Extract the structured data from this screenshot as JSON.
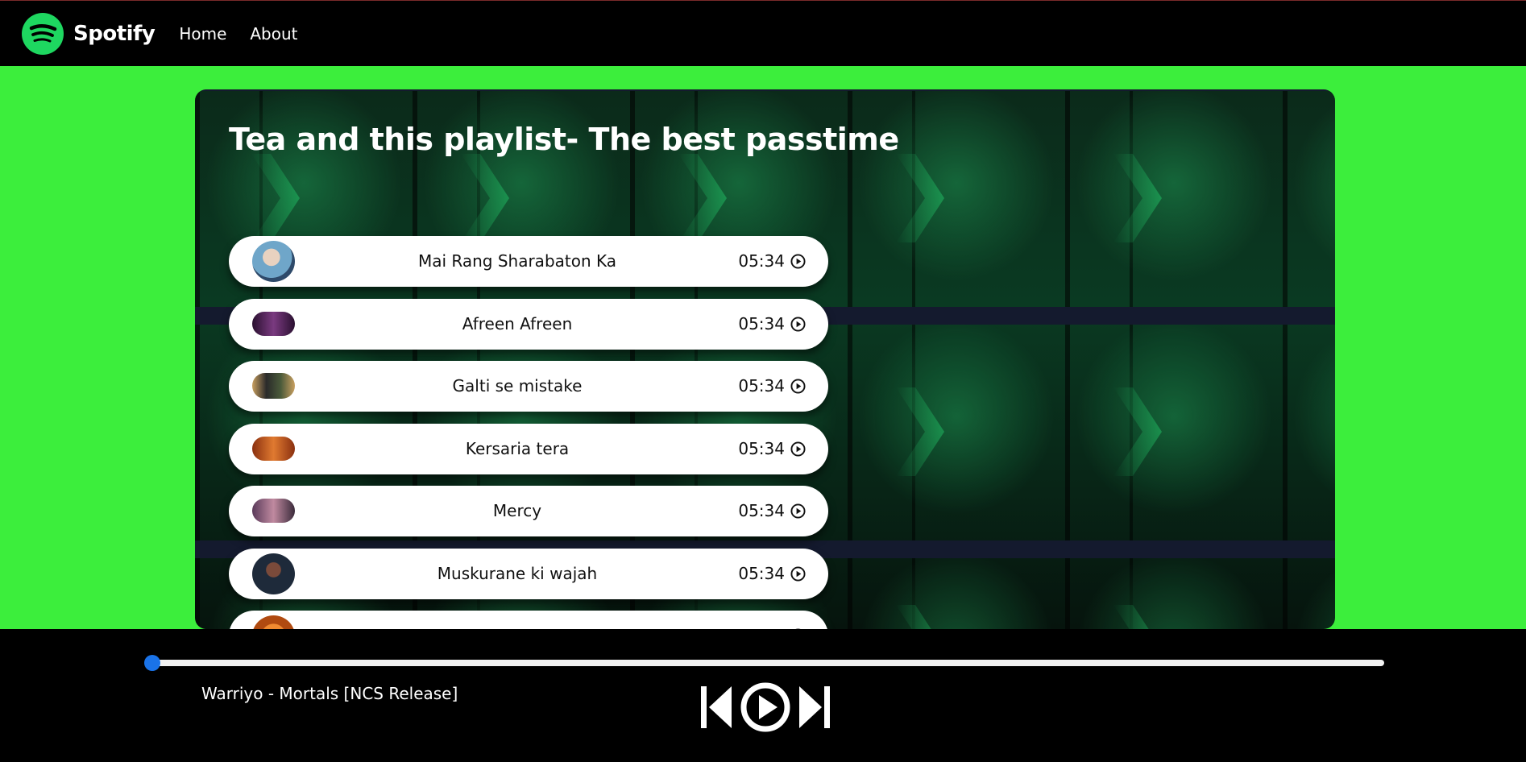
{
  "nav": {
    "brand": "Spotify",
    "links": [
      "Home",
      "About"
    ]
  },
  "playlist": {
    "title": "Tea and this playlist- The best passtime",
    "songs": [
      {
        "name": "Mai Rang Sharabaton Ka",
        "duration": "05:34",
        "thumb_color": "#6fa6c9"
      },
      {
        "name": "Afreen Afreen",
        "duration": "05:34",
        "thumb_color": "#5a2a5e"
      },
      {
        "name": "Galti se mistake",
        "duration": "05:34",
        "thumb_color": "#3a4a2a"
      },
      {
        "name": "Kersaria tera",
        "duration": "05:34",
        "thumb_color": "#c0552a"
      },
      {
        "name": "Mercy",
        "duration": "05:34",
        "thumb_color": "#7a4a6a"
      },
      {
        "name": "Muskurane ki wajah",
        "duration": "05:34",
        "thumb_color": "#1e2a3a"
      },
      {
        "name": "",
        "duration": "",
        "thumb_color": "#d4641e"
      }
    ]
  },
  "player": {
    "now_playing": "Warriyo - Mortals [NCS Release]",
    "progress": 0.0
  },
  "colors": {
    "page_bg": "#3cee3c",
    "brand_green": "#1ed760",
    "progress_thumb": "#1a73e8"
  },
  "icons": [
    "spotify-logo-icon",
    "play-circle-icon",
    "previous-icon",
    "next-icon"
  ]
}
